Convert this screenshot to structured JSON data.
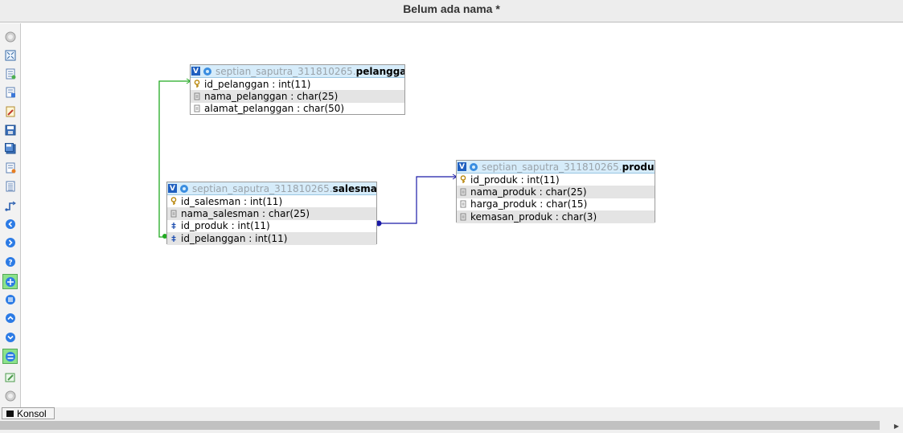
{
  "window": {
    "title": "Belum ada nama *"
  },
  "toolbar": {
    "items": [
      {
        "icon": "circle-icon"
      },
      {
        "icon": "fullscreen-icon"
      },
      {
        "icon": "page-icon"
      },
      {
        "icon": "page-add-icon"
      },
      {
        "icon": "page-edit-icon"
      },
      {
        "icon": "save-icon"
      },
      {
        "icon": "save-all-icon"
      },
      {
        "icon": "export-icon"
      },
      {
        "icon": "list-icon"
      },
      {
        "icon": "relation-icon"
      },
      {
        "icon": "arrow-left-icon"
      },
      {
        "icon": "arrow-right-icon"
      },
      {
        "icon": "help-icon"
      },
      {
        "icon": "toggle-icon"
      },
      {
        "icon": "angle-icon"
      },
      {
        "icon": "arrow-up-icon"
      },
      {
        "icon": "arrow-down-icon"
      },
      {
        "icon": "refresh-icon"
      },
      {
        "icon": "edit-icon"
      },
      {
        "icon": "circle-icon"
      }
    ]
  },
  "tables": {
    "pelanggan": {
      "db": "septian_saputra_311810265",
      "name": "pelanggan",
      "columns": [
        {
          "text": "id_pelanggan : int(11)",
          "icon": "key-icon"
        },
        {
          "text": "nama_pelanggan : char(25)",
          "icon": "field-icon"
        },
        {
          "text": "alamat_pelanggan : char(50)",
          "icon": "field-icon"
        }
      ]
    },
    "salesman": {
      "db": "septian_saputra_311810265",
      "name": "salesman",
      "columns": [
        {
          "text": "id_salesman : int(11)",
          "icon": "key-icon"
        },
        {
          "text": "nama_salesman : char(25)",
          "icon": "field-icon"
        },
        {
          "text": "id_produk : int(11)",
          "icon": "foreign-key-icon"
        },
        {
          "text": "id_pelanggan : int(11)",
          "icon": "foreign-key-icon"
        }
      ]
    },
    "produk": {
      "db": "septian_saputra_311810265",
      "name": "produk",
      "columns": [
        {
          "text": "id_produk : int(11)",
          "icon": "key-icon"
        },
        {
          "text": "nama_produk : char(25)",
          "icon": "field-icon"
        },
        {
          "text": "harga_produk : char(15)",
          "icon": "field-icon"
        },
        {
          "text": "kemasan_produk : char(3)",
          "icon": "field-icon"
        }
      ]
    }
  },
  "relations": [
    {
      "from": "salesman.id_pelanggan",
      "to": "pelanggan.id_pelanggan",
      "color": "#22aa22"
    },
    {
      "from": "salesman.id_produk",
      "to": "produk.id_produk",
      "color": "#1a1aa6"
    }
  ],
  "colors": {
    "header_bg": "#d6ecfa",
    "alt_row": "#e4e4e4",
    "active_tool": "#8be28b"
  },
  "console": {
    "label": "Konsol"
  }
}
